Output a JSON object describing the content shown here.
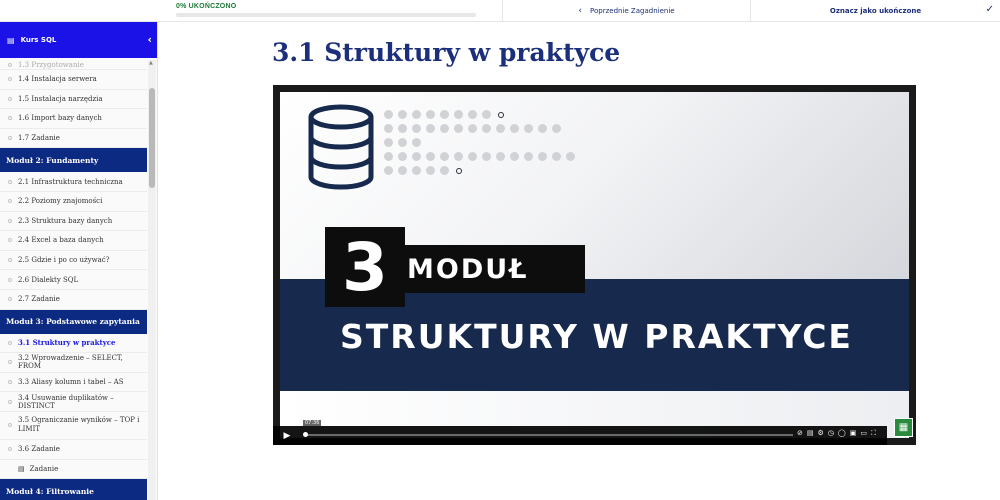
{
  "progress": {
    "label": "0% UKOŃCZONO",
    "fraction": 0.0
  },
  "nav": {
    "prev_label": "Poprzednie Zagadnienie",
    "mark_label": "Oznacz jako ukończone"
  },
  "sidebar": {
    "course_title": "Kurs SQL",
    "partial_item": "1.3 Przygotowanie",
    "items_top": [
      {
        "label": "1.4 Instalacja serwera"
      },
      {
        "label": "1.5 Instalacja narzędzia"
      },
      {
        "label": "1.6 Import bazy danych"
      },
      {
        "label": "1.7 Zadanie"
      }
    ],
    "module2": "Moduł 2: Fundamenty",
    "items_m2": [
      {
        "label": "2.1 Infrastruktura techniczna"
      },
      {
        "label": "2.2 Poziomy znajomości"
      },
      {
        "label": "2.3 Struktura bazy danych"
      },
      {
        "label": "2.4 Excel a baza danych"
      },
      {
        "label": "2.5 Gdzie i po co używać?"
      },
      {
        "label": "2.6 Dialekty SQL"
      },
      {
        "label": "2.7 Zadanie"
      }
    ],
    "module3": "Moduł 3: Podstawowe zapytania",
    "items_m3": [
      {
        "label": "3.1 Struktury w praktyce"
      },
      {
        "label": "3.2 Wprowadzenie – SELECT, FROM"
      },
      {
        "label": "3.3 Aliasy kolumn i tabel – AS"
      },
      {
        "label": "3.4 Usuwanie duplikatów – DISTINCT"
      },
      {
        "label": "3.5 Ograniczanie wyników – TOP i LIMIT"
      },
      {
        "label": "3.6 Zadanie"
      },
      {
        "label": "Zadanie"
      }
    ],
    "module4": "Moduł 4: Filtrowanie"
  },
  "main": {
    "title": "3.1 Struktury w praktyce"
  },
  "video": {
    "number": "3",
    "modul": "MODUŁ",
    "topic": "STRUKTURY W PRAKTYCE",
    "time": "07:36",
    "colors": {
      "navy": "#172a4d",
      "black": "#0d0d0d"
    }
  },
  "icons": {
    "collapse": "chevron-left-icon",
    "prev": "chevron-left-icon",
    "mark": "check-icon",
    "book": "book-icon",
    "play": "play-icon"
  }
}
